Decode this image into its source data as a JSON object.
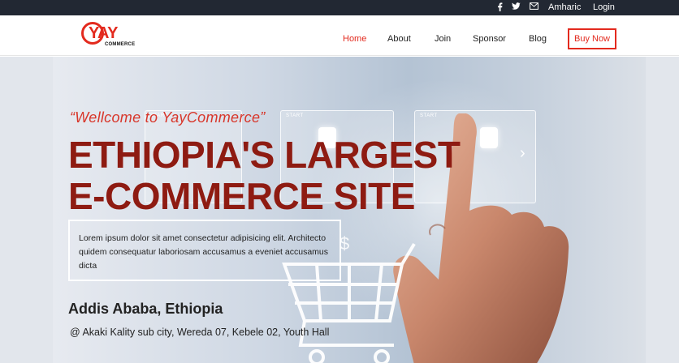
{
  "topbar": {
    "social": [
      {
        "icon": "facebook-icon",
        "glyph": "f"
      },
      {
        "icon": "twitter-icon",
        "glyph": "🐦"
      },
      {
        "icon": "mail-icon",
        "glyph": "✉"
      }
    ],
    "language_label": "Amharic",
    "login_label": "Login"
  },
  "logo": {
    "main": "YAY",
    "sub": "COMMERCE"
  },
  "nav": {
    "items": [
      "Home",
      "About",
      "Join",
      "Sponsor",
      "Blog"
    ],
    "active": "Home",
    "cta_label": "Buy Now"
  },
  "hero": {
    "tagline": "“Wellcome to YayCommerce”",
    "headline_line1": "ETHIOPIA'S LARGEST",
    "headline_line2": "E-COMMERCE SITE",
    "description": "Lorem ipsum dolor sit amet consectetur adipisicing elit. Architecto quidem consequatur laboriosam accusamus a eveniet accusamus dicta",
    "city": "Addis Ababa, Ethiopia",
    "address": "@ Akaki Kality sub city, Wereda 07, Kebele 02, Youth Hall",
    "panel_labels": [
      "START",
      "START",
      "START"
    ],
    "dollar_icon": "$",
    "chevron_icon": "›"
  },
  "colors": {
    "accent": "#e32a1e",
    "headline": "#8e1b12",
    "topbar_bg": "#222833"
  }
}
